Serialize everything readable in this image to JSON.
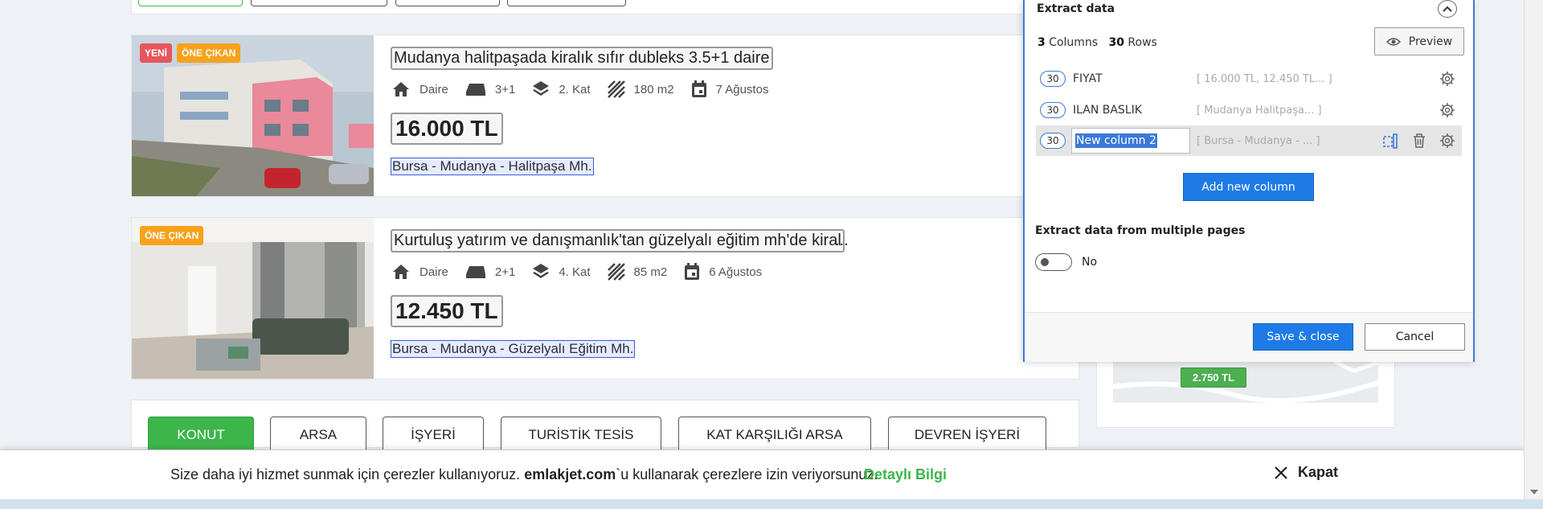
{
  "listings": [
    {
      "title": "Mudanya halitpaşada kiralık sıfır dubleks 3.5+1 daire",
      "title_suffix": "",
      "badges": [
        "YENİ",
        "ÖNE ÇIKAN"
      ],
      "type": "Daire",
      "rooms": "3+1",
      "floor": "2. Kat",
      "area": "180 m2",
      "date": "7 Ağustos",
      "price": "16.000 TL",
      "location": "Bursa - Mudanya - Halitpaşa Mh."
    },
    {
      "title": "Kurtuluş yatırım ve danışmanlık'tan güzelyalı eğitim mh'de kiral",
      "title_suffix": "...",
      "badges": [
        "ÖNE ÇIKAN"
      ],
      "type": "Daire",
      "rooms": "2+1",
      "floor": "4. Kat",
      "area": "85 m2",
      "date": "6 Ağustos",
      "price": "12.450 TL",
      "location": "Bursa - Mudanya - Güzelyalı Eğitim Mh."
    }
  ],
  "categories": [
    "KONUT",
    "ARSA",
    "İŞYERİ",
    "TURİSTİK TESİS",
    "KAT KARŞILIĞI ARSA",
    "DEVREN İŞYERİ"
  ],
  "active_category": "KONUT",
  "map": {
    "pin_price": "2.750 TL"
  },
  "cookie": {
    "text_before": "Size daha iyi hizmet sunmak için çerezler kullanıyoruz. ",
    "brand": "emlakjet.com",
    "text_after": "`u kullanarak çerezlere izin veriyorsunuz.",
    "more_label": "Detaylı Bilgi",
    "close_label": "Kapat"
  },
  "extract_panel": {
    "title": "Extract data",
    "columns_count": "3",
    "columns_label": "Columns",
    "rows_count": "30",
    "rows_label": "Rows",
    "preview_label": "Preview",
    "columns": [
      {
        "count": "30",
        "name": "FIYAT",
        "sample": "[ 16.000 TL, 12.450 TL... ]"
      },
      {
        "count": "30",
        "name": "ILAN BASLIK",
        "sample": "[ Mudanya Halitpaşa...  ]"
      },
      {
        "count": "30",
        "name": "New column 2",
        "sample": "[ Bursa - Mudanya - ...  ]"
      }
    ],
    "add_column_label": "Add new column",
    "multi_pages_label": "Extract data from multiple pages",
    "multi_pages_value": "No",
    "save_label": "Save & close",
    "cancel_label": "Cancel"
  },
  "colors": {
    "accent_green": "#3cb54a",
    "panel_blue": "#1e7be6",
    "badge_new": "#e6555a",
    "badge_featured": "#f7a21b"
  }
}
